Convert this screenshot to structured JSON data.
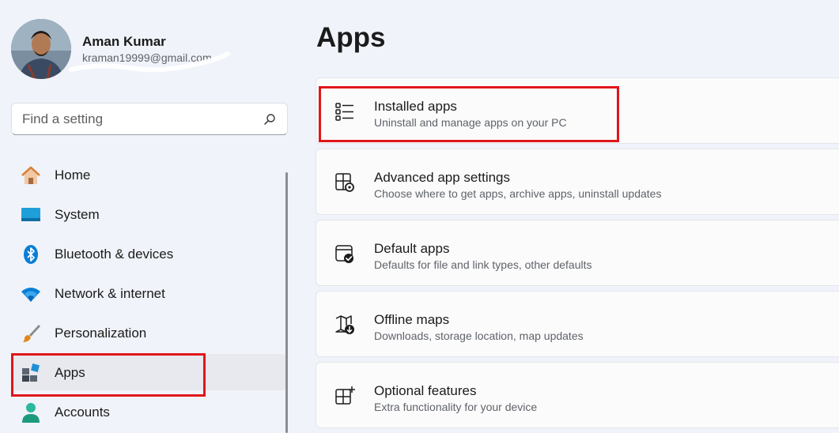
{
  "user": {
    "name": "Aman Kumar",
    "email": "kraman19999@gmail.com"
  },
  "search": {
    "placeholder": "Find a setting"
  },
  "nav": [
    {
      "label": "Home",
      "icon": "home-icon"
    },
    {
      "label": "System",
      "icon": "system-icon"
    },
    {
      "label": "Bluetooth & devices",
      "icon": "bluetooth-icon"
    },
    {
      "label": "Network & internet",
      "icon": "wifi-icon"
    },
    {
      "label": "Personalization",
      "icon": "brush-icon"
    },
    {
      "label": "Apps",
      "icon": "apps-icon",
      "selected": true
    },
    {
      "label": "Accounts",
      "icon": "accounts-icon"
    }
  ],
  "page": {
    "title": "Apps"
  },
  "cards": [
    {
      "title": "Installed apps",
      "subtitle": "Uninstall and manage apps on your PC",
      "icon": "list-icon"
    },
    {
      "title": "Advanced app settings",
      "subtitle": "Choose where to get apps, archive apps, uninstall updates",
      "icon": "app-settings-icon"
    },
    {
      "title": "Default apps",
      "subtitle": "Defaults for file and link types, other defaults",
      "icon": "default-apps-icon"
    },
    {
      "title": "Offline maps",
      "subtitle": "Downloads, storage location, map updates",
      "icon": "map-download-icon"
    },
    {
      "title": "Optional features",
      "subtitle": "Extra functionality for your device",
      "icon": "optional-features-icon"
    }
  ],
  "colors": {
    "highlight": "#e0161b",
    "accent": "#0067c0",
    "background": "#f0f3f9"
  }
}
